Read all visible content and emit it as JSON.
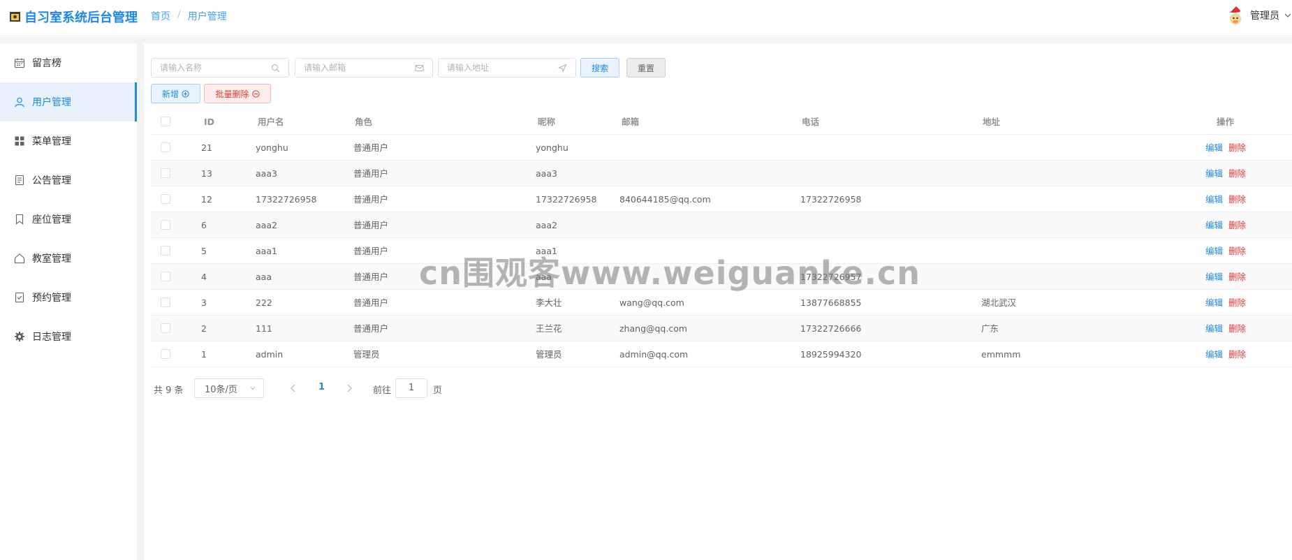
{
  "app": {
    "title": "自习室系统后台管理"
  },
  "breadcrumb": {
    "home": "首页",
    "separator": "/",
    "current": "用户管理"
  },
  "user": {
    "name": "管理员"
  },
  "sidebar": {
    "items": [
      {
        "label": "留言榜",
        "icon": "calendar-icon"
      },
      {
        "label": "用户管理",
        "icon": "user-icon",
        "active": true
      },
      {
        "label": "菜单管理",
        "icon": "grid-icon"
      },
      {
        "label": "公告管理",
        "icon": "document-icon"
      },
      {
        "label": "座位管理",
        "icon": "bookmark-icon"
      },
      {
        "label": "教室管理",
        "icon": "house-icon"
      },
      {
        "label": "预约管理",
        "icon": "checklist-icon"
      },
      {
        "label": "日志管理",
        "icon": "gear-icon"
      }
    ]
  },
  "search": {
    "name_placeholder": "请输入名称",
    "email_placeholder": "请输入邮箱",
    "address_placeholder": "请输入地址",
    "search_label": "搜索",
    "reset_label": "重置"
  },
  "actions": {
    "add_label": "新增",
    "batch_delete_label": "批量删除"
  },
  "table": {
    "headers": {
      "id": "ID",
      "username": "用户名",
      "role": "角色",
      "nickname": "昵称",
      "email": "邮箱",
      "phone": "电话",
      "address": "地址",
      "ops": "操作"
    },
    "edit_label": "编辑",
    "delete_label": "删除",
    "rows": [
      {
        "id": "21",
        "username": "yonghu",
        "role": "普通用户",
        "nickname": "yonghu",
        "email": "",
        "phone": "",
        "address": ""
      },
      {
        "id": "13",
        "username": "aaa3",
        "role": "普通用户",
        "nickname": "aaa3",
        "email": "",
        "phone": "",
        "address": ""
      },
      {
        "id": "12",
        "username": "17322726958",
        "role": "普通用户",
        "nickname": "17322726958",
        "email": "840644185@qq.com",
        "phone": "17322726958",
        "address": ""
      },
      {
        "id": "6",
        "username": "aaa2",
        "role": "普通用户",
        "nickname": "aaa2",
        "email": "",
        "phone": "",
        "address": ""
      },
      {
        "id": "5",
        "username": "aaa1",
        "role": "普通用户",
        "nickname": "aaa1",
        "email": "",
        "phone": "",
        "address": ""
      },
      {
        "id": "4",
        "username": "aaa",
        "role": "普通用户",
        "nickname": "aaa",
        "email": "",
        "phone": "17322726957",
        "address": ""
      },
      {
        "id": "3",
        "username": "222",
        "role": "普通用户",
        "nickname": "李大壮",
        "email": "wang@qq.com",
        "phone": "13877668855",
        "address": "湖北武汉"
      },
      {
        "id": "2",
        "username": "111",
        "role": "普通用户",
        "nickname": "王兰花",
        "email": "zhang@qq.com",
        "phone": "17322726666",
        "address": "广东"
      },
      {
        "id": "1",
        "username": "admin",
        "role": "管理员",
        "nickname": "管理员",
        "email": "admin@qq.com",
        "phone": "18925994320",
        "address": "emmmm"
      }
    ]
  },
  "pagination": {
    "total": "共 9 条",
    "page_size": "10条/页",
    "current_page": "1",
    "goto_prefix": "前往",
    "goto_value": "1",
    "goto_suffix": "页"
  },
  "watermark": "cn围观客www.weiguanke.cn",
  "colors": {
    "accent": "#1e88e5",
    "danger": "#e23b3b",
    "backdrop": "#f2f3f5",
    "active_bg": "#e6f1fc"
  }
}
